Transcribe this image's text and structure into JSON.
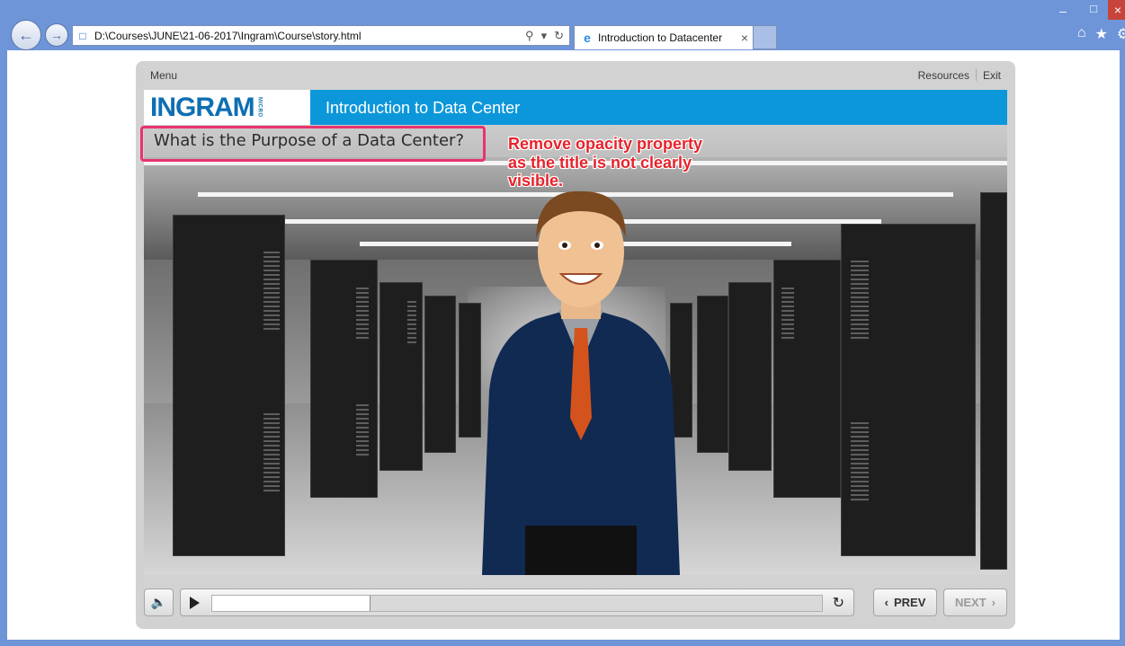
{
  "browser": {
    "address_url": "D:\\Courses\\JUNE\\21-06-2017\\Ingram\\Course\\story.html",
    "tab_title": "Introduction to Datacenter",
    "tab_close": "×",
    "search_glyph": "⚲",
    "dropdown_glyph": "▾",
    "refresh_glyph": "↻",
    "back_glyph": "←",
    "forward_glyph": "→",
    "home_glyph": "⌂",
    "favorites_glyph": "★",
    "settings_glyph": "⚙",
    "min_glyph": "–",
    "max_glyph": "□",
    "close_glyph": "×"
  },
  "player": {
    "menu_label": "Menu",
    "resources_label": "Resources",
    "exit_label": "Exit",
    "logo_text": "INGRAM",
    "logo_micro": "MICRO",
    "course_title": "Introduction to Data Center",
    "slide_question": "What is the Purpose of a Data Center?",
    "progress_fraction": 0.26,
    "prev_label": "PREV",
    "next_label": "NEXT",
    "prev_glyph": "‹",
    "next_glyph": "›",
    "volume_glyph": "🔈",
    "replay_glyph": "↻"
  },
  "annotation": {
    "note": "Remove opacity property as the title is not clearly visible.",
    "color": "#e6232c",
    "box_color": "#e8336e"
  }
}
